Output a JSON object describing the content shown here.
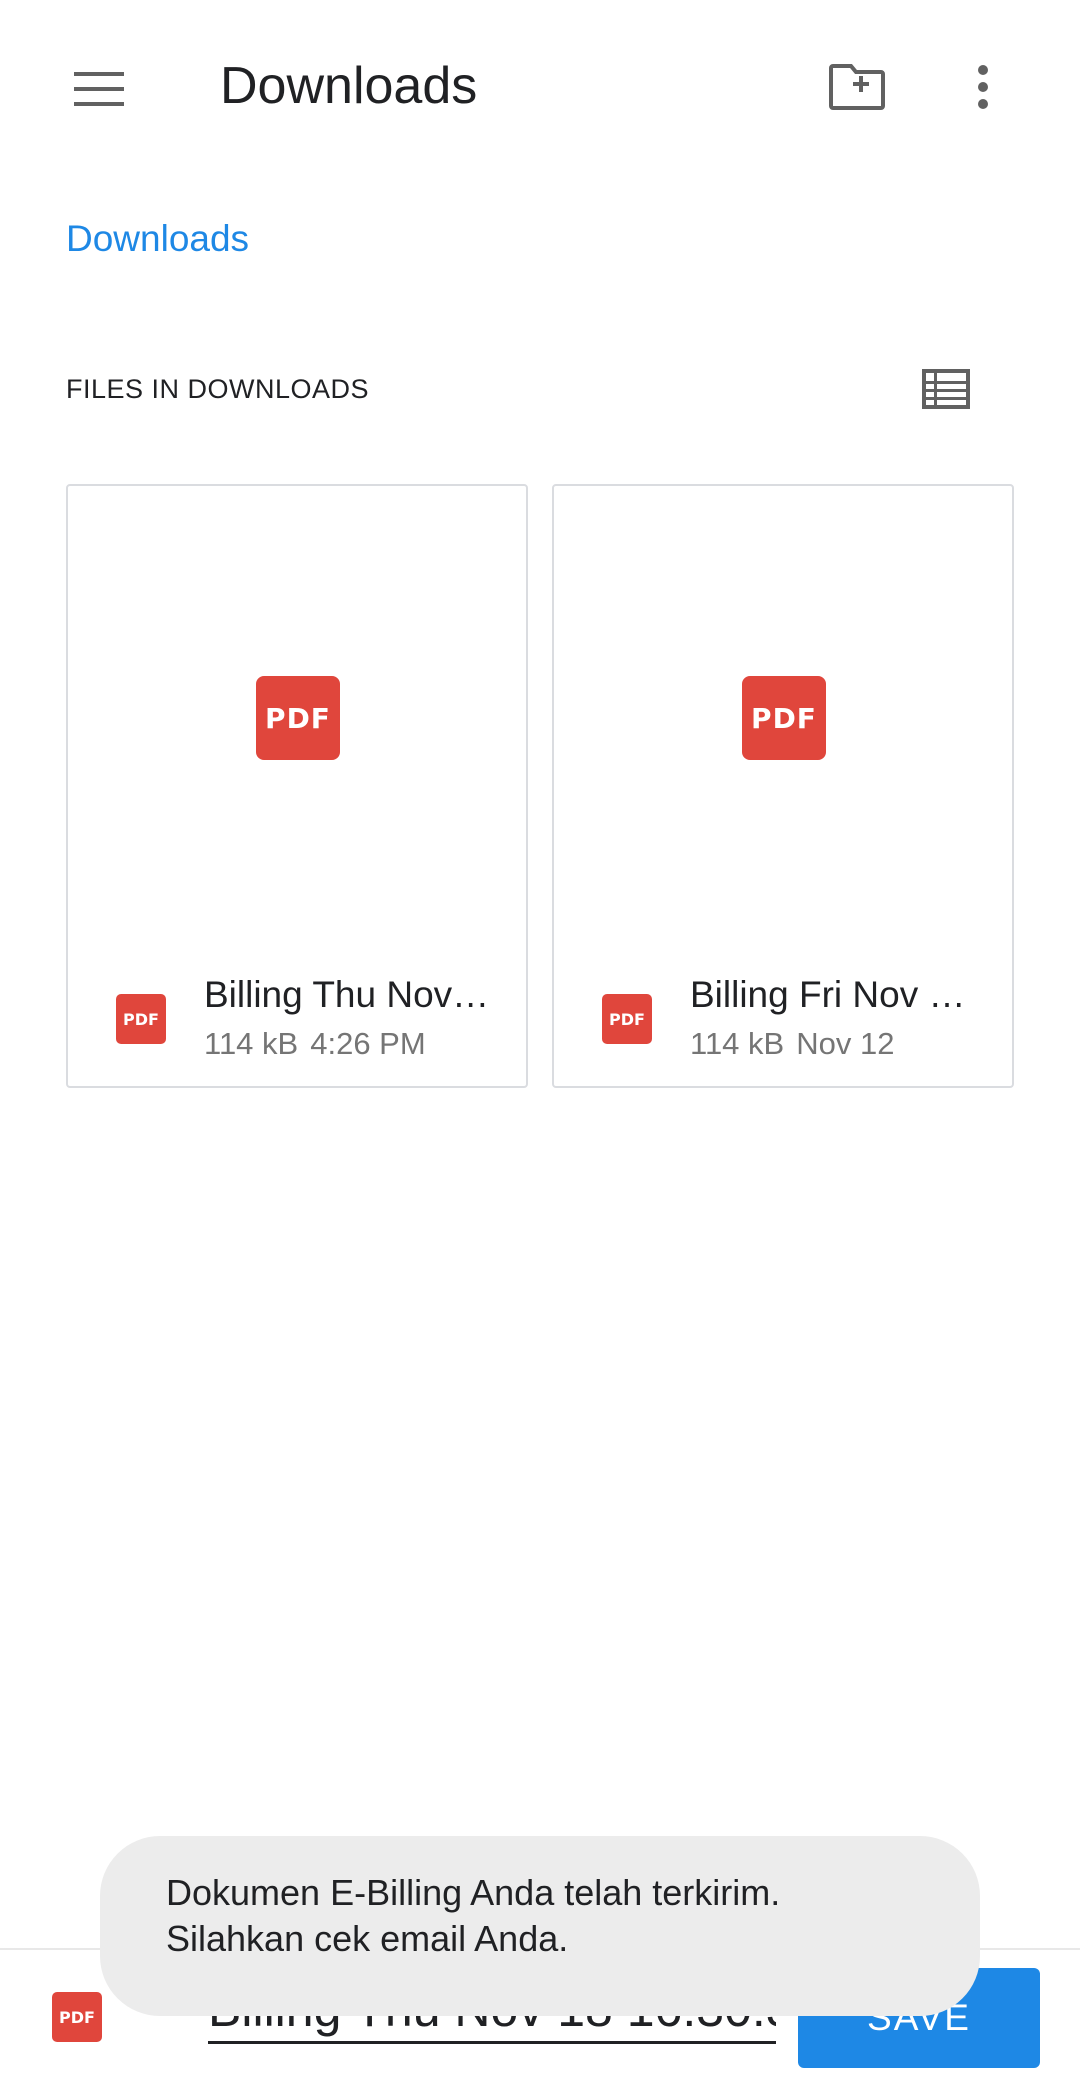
{
  "app_bar": {
    "title": "Downloads",
    "icons": [
      "menu-icon",
      "new-folder-icon",
      "more-vert-icon"
    ]
  },
  "breadcrumb": {
    "current": "Downloads"
  },
  "section": {
    "header": "FILES IN DOWNLOADS",
    "view_toggle_icon": "list-view-icon"
  },
  "files": [
    {
      "type_label": "PDF",
      "name": "Billing Thu Nov…",
      "size": "114 kB",
      "date": "4:26 PM"
    },
    {
      "type_label": "PDF",
      "name": "Billing Fri Nov …",
      "size": "114 kB",
      "date": "Nov 12"
    }
  ],
  "save_bar": {
    "type_label": "PDF",
    "filename_value": "Billing Thu Nov 18 16:30:3",
    "save_label": "SAVE"
  },
  "toast": {
    "line1": "Dokumen E-Billing Anda telah terkirim.",
    "line2": "Silahkan cek email Anda."
  },
  "colors": {
    "accent": "#1e88e5",
    "pdf_red": "#e0463c",
    "toast_bg": "#ececec"
  }
}
